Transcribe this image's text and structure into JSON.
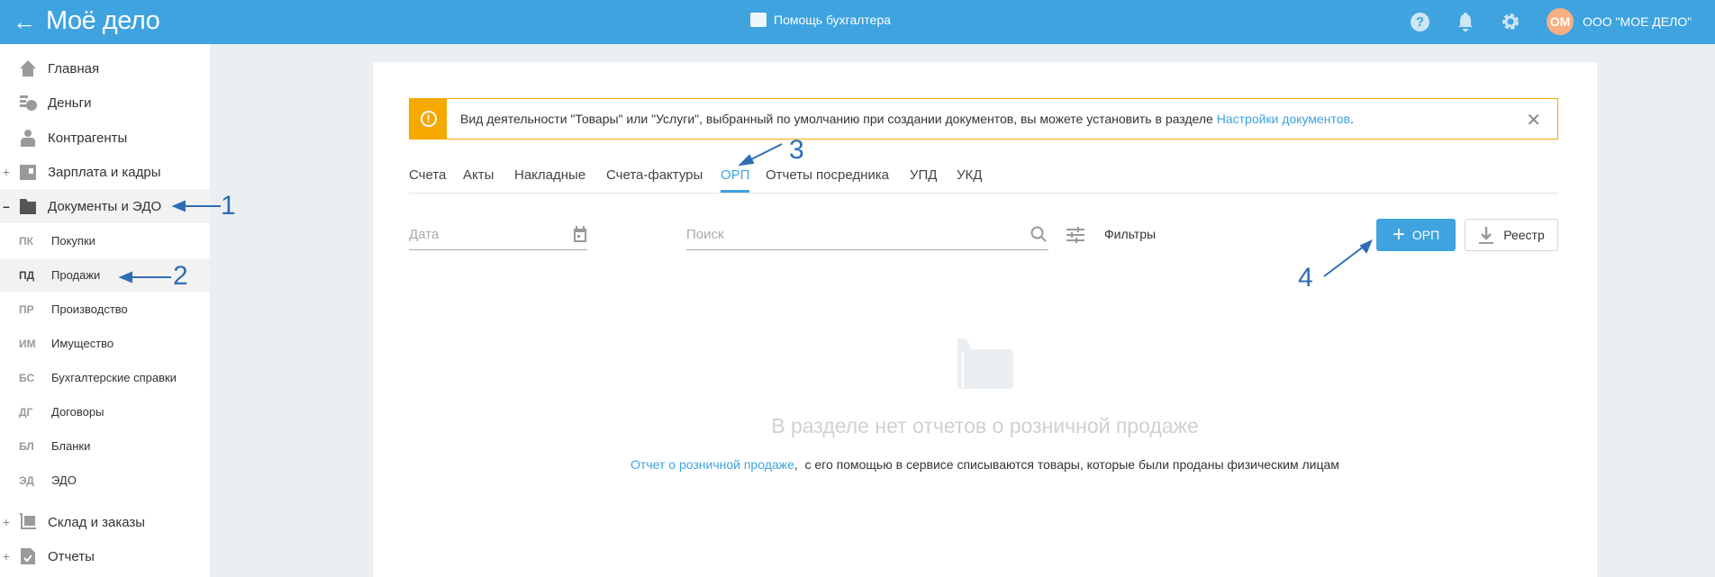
{
  "header": {
    "logo": "Моё дело",
    "center_label": "Помощь бухгалтера",
    "avatar_initials": "ОМ",
    "company": "ООО \"МОЕ ДЕЛО\""
  },
  "sidebar": {
    "items": [
      {
        "label": "Главная",
        "icon": "home-icon"
      },
      {
        "label": "Деньги",
        "icon": "money-icon"
      },
      {
        "label": "Контрагенты",
        "icon": "contractor-icon"
      },
      {
        "label": "Зарплата и кадры",
        "icon": "wallet-icon",
        "toggle": "+"
      },
      {
        "label": "Документы и ЭДО",
        "icon": "folder-icon",
        "toggle": "–"
      }
    ],
    "subitems": [
      {
        "abbr": "ПК",
        "label": "Покупки"
      },
      {
        "abbr": "ПД",
        "label": "Продажи"
      },
      {
        "abbr": "ПР",
        "label": "Производство"
      },
      {
        "abbr": "ИМ",
        "label": "Имущество"
      },
      {
        "abbr": "БС",
        "label": "Бухгалтерские справки"
      },
      {
        "abbr": "ДГ",
        "label": "Договоры"
      },
      {
        "abbr": "БЛ",
        "label": "Бланки"
      },
      {
        "abbr": "ЭД",
        "label": "ЭДО"
      }
    ],
    "bottom": [
      {
        "label": "Склад и заказы",
        "toggle": "+"
      },
      {
        "label": "Отчеты",
        "toggle": "+"
      }
    ]
  },
  "alert": {
    "text": "Вид деятельности \"Товары\" или \"Услуги\", выбранный по умолчанию при создании документов, вы можете установить в разделе ",
    "link": "Настройки документов",
    "end": "."
  },
  "tabs": [
    "Счета",
    "Акты",
    "Накладные",
    "Счета-фактуры",
    "ОРП",
    "Отчеты посредника",
    "УПД",
    "УКД"
  ],
  "filters": {
    "date_placeholder": "Дата",
    "search_placeholder": "Поиск",
    "filters_label": "Фильтры"
  },
  "buttons": {
    "add": "ОРП",
    "registry": "Реестр"
  },
  "empty": {
    "title": "В разделе нет отчетов о розничной продаже",
    "link": "Отчет о розничной продаже",
    "text": ",  с его помощью в сервисе списываются товары, которые были проданы физическим лицам"
  },
  "annotations": [
    "1",
    "2",
    "3",
    "4"
  ],
  "colors": {
    "accent": "#3ea3df",
    "warning": "#f5a800",
    "annotation": "#2f6db5"
  }
}
